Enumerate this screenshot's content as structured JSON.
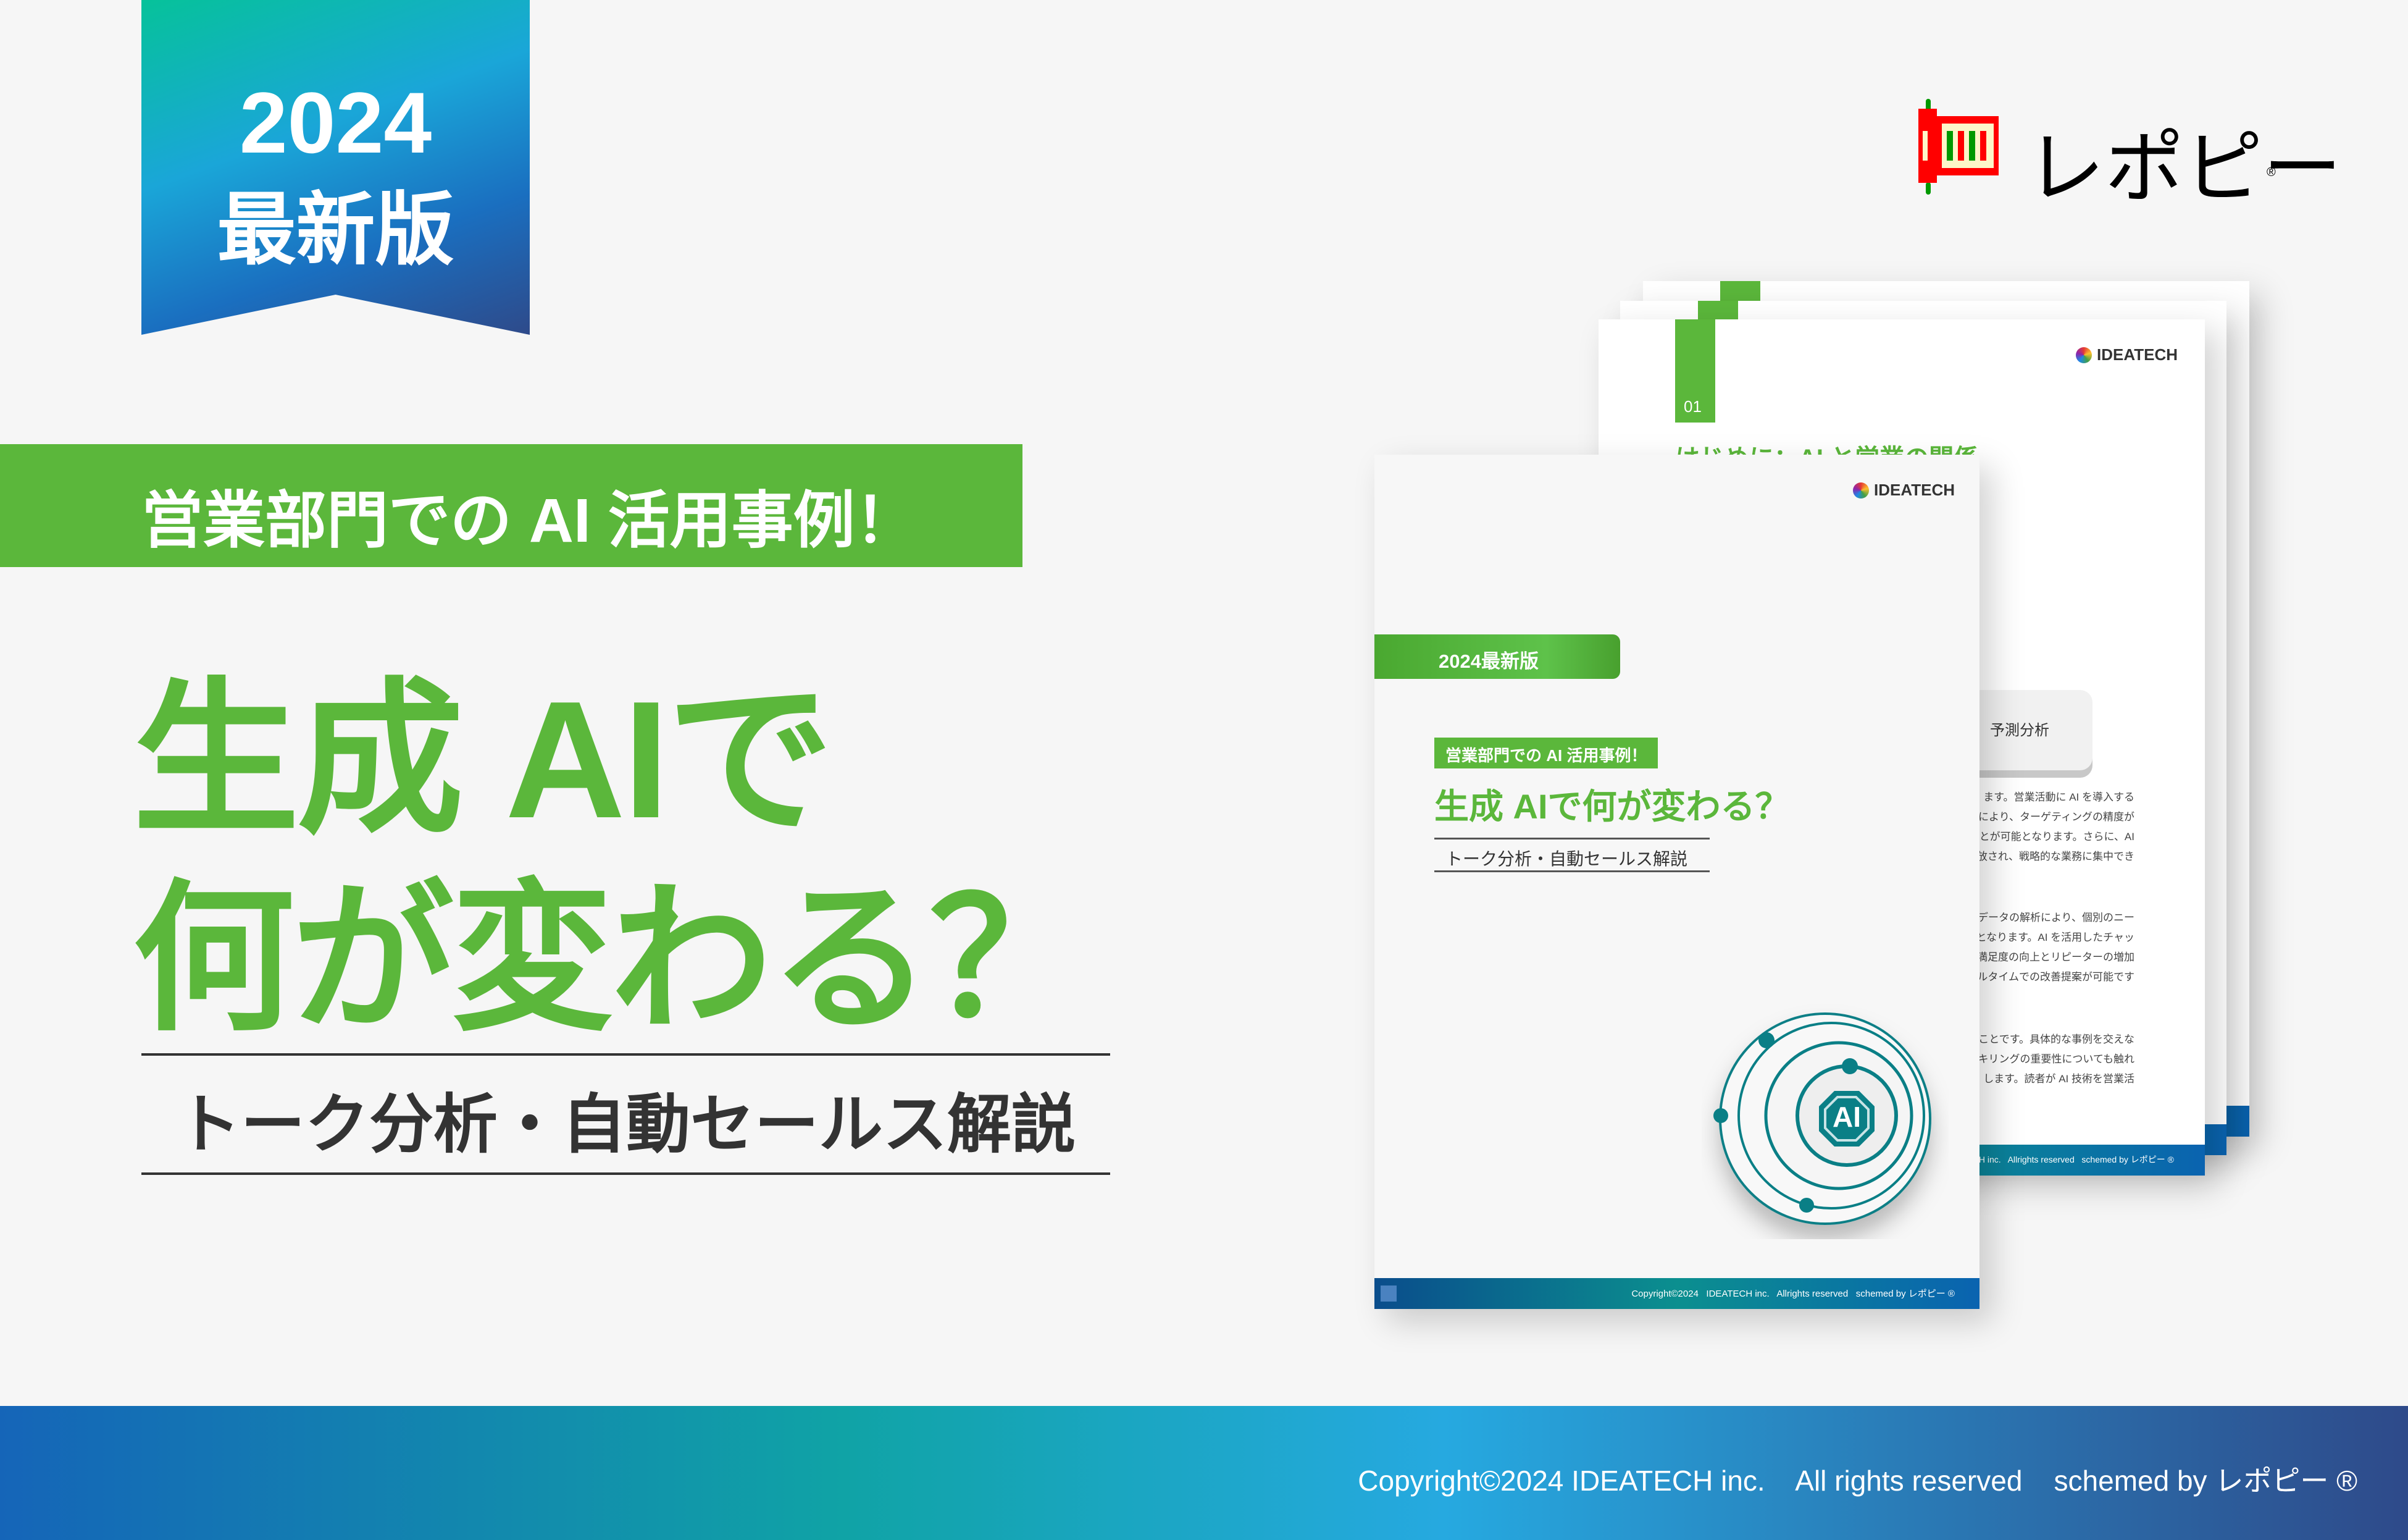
{
  "ribbon": {
    "year": "2024",
    "edition": "最新版"
  },
  "band": {
    "label": "営業部門での AI 活用事例！"
  },
  "title": {
    "line1": "生成 AIで",
    "line2": "何が変わる？"
  },
  "subtitle": "トーク分析・自動セールス解説",
  "brand": {
    "name": "レポピー",
    "mark": "®",
    "colors": {
      "red": "#ff0000",
      "green": "#009900",
      "cream": "#fdf6c8"
    }
  },
  "footer": {
    "copyright": "Copyright©2024 IDEATECH inc.    All rights reserved    schemed by レポピー ®"
  },
  "colors": {
    "accent": "#5bb73b",
    "teal": "#0a7f86"
  },
  "brochure": {
    "back_page": {
      "number": "01",
      "heading": "はじめに：AI と営業の関係",
      "card": "予測分析",
      "paragraphs": [
        [
          "ます。営業活動に AI を導入する",
          "により、ターゲティングの精度が",
          "とが可能となります。さらに、AI",
          "放され、戦略的な業務に集中でき"
        ],
        [
          "データの解析により、個別のニー",
          "となります。AI を活用したチャッ",
          "満足度の向上とリピーターの増加",
          "ルタイムでの改善提案が可能です。"
        ],
        [
          "ことです。具体的な事例を交えな",
          "キリングの重要性についても触れ",
          "します。読者が AI 技術を営業活"
        ]
      ],
      "footer": "24  IDEATECH inc.   Allrights reserved   schemed by レポピー ®"
    },
    "front_page": {
      "logo": "IDEATECH",
      "edition_tab": "2024最新版",
      "label": "営業部門での AI 活用事例！",
      "title": "生成 AIで何が変わる？",
      "subtitle": "トーク分析・自動セールス解説",
      "badge": "AI",
      "footer": "Copyright©2024   IDEATECH inc.   Allrights reserved   schemed by レポピー ®"
    }
  }
}
